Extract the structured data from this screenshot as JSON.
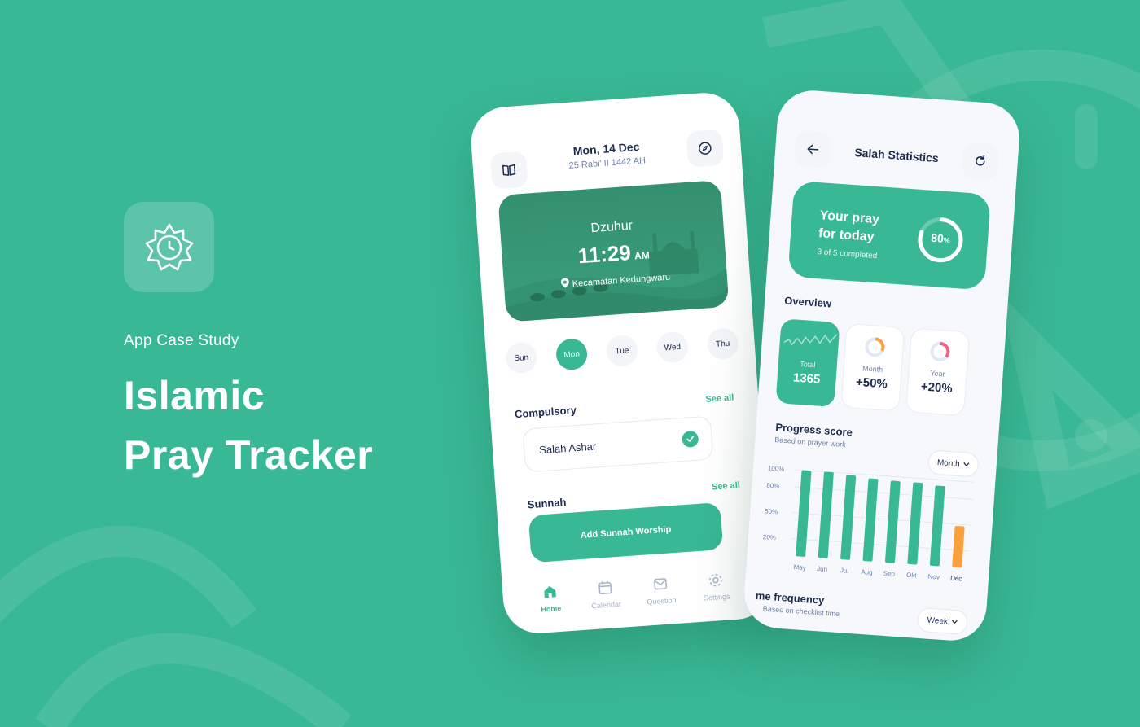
{
  "hero": {
    "label": "App Case Study",
    "title_line1": "Islamic",
    "title_line2": "Pray Tracker"
  },
  "home": {
    "date": "Mon, 14 Dec",
    "hijri": "25 Rabi' II 1442 AH",
    "prayer_name": "Dzuhur",
    "prayer_time": "11:29",
    "prayer_meridiem": "AM",
    "location": "Kecamatan Kedungwaru",
    "days": [
      {
        "label": "Sun",
        "active": false
      },
      {
        "label": "Mon",
        "active": true
      },
      {
        "label": "Tue",
        "active": false
      },
      {
        "label": "Wed",
        "active": false
      },
      {
        "label": "Thu",
        "active": false
      }
    ],
    "compulsory_title": "Compulsory",
    "compulsory_see_all": "See all",
    "compulsory_item": "Salah Ashar",
    "sunnah_title": "Sunnah",
    "sunnah_see_all": "See all",
    "add_button": "Add Sunnah Worship",
    "nav": [
      {
        "label": "Home",
        "icon": "home-icon",
        "active": true
      },
      {
        "label": "Calendar",
        "icon": "calendar-icon",
        "active": false
      },
      {
        "label": "Question",
        "icon": "mail-icon",
        "active": false
      },
      {
        "label": "Settings",
        "icon": "gear-icon",
        "active": false
      }
    ]
  },
  "stats": {
    "title": "Salah Statistics",
    "today_title_line1": "Your pray",
    "today_title_line2": "for today",
    "today_count": "3 of 5 completed",
    "today_percent": "80",
    "today_percent_unit": "%",
    "today_progress": 0.8,
    "overview_title": "Overview",
    "overview": [
      {
        "label": "Total",
        "value": "1365"
      },
      {
        "label": "Month",
        "value": "+50%"
      },
      {
        "label": "Year",
        "value": "+20%"
      }
    ],
    "progress_title": "Progress score",
    "progress_sub": "Based on prayer work",
    "progress_filter": "Month",
    "frequency_title": "me frequency",
    "frequency_sub": "Based on checklist time",
    "frequency_filter": "Week",
    "colors": {
      "accent": "#39b895",
      "highlight": "#f9a03f",
      "track": "#dce3ee"
    }
  },
  "chart_data": {
    "type": "bar",
    "categories": [
      "May",
      "Jun",
      "Jul",
      "Aug",
      "Sep",
      "Okt",
      "Nov",
      "Dec"
    ],
    "values": [
      100,
      100,
      98,
      96,
      95,
      95,
      93,
      48
    ],
    "ylim": [
      0,
      100
    ],
    "ytick_labels": [
      "100%",
      "80%",
      "50%",
      "20%"
    ],
    "highlight_category": "Dec"
  }
}
